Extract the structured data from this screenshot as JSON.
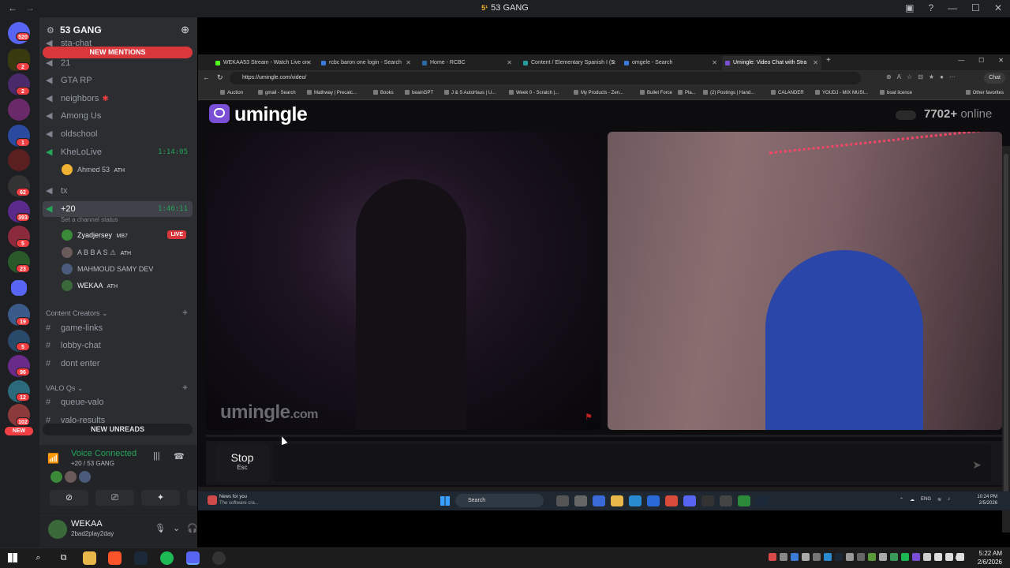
{
  "window": {
    "title": "53 GANG",
    "back": "←",
    "forward": "→"
  },
  "servers": {
    "badges": [
      "520",
      "2",
      "2",
      "1",
      "62",
      "393",
      "5",
      "23",
      "19",
      "5",
      "96",
      "12",
      "102"
    ],
    "new_label": "NEW"
  },
  "guild": {
    "name": "53 GANG",
    "chevron": "⌄"
  },
  "channels": {
    "new_mentions": "NEW MENTIONS",
    "new_unreads": "NEW UNREADS",
    "list": [
      {
        "name": "sta-chat"
      },
      {
        "name": "21"
      },
      {
        "name": "GTA RP"
      },
      {
        "name": "neighbors"
      },
      {
        "name": "Among Us"
      },
      {
        "name": "oldschool"
      },
      {
        "name": "KheLoLive",
        "time": "1:14:05"
      },
      {
        "name": "tx"
      },
      {
        "name": "+20",
        "time": "1:46:11"
      }
    ],
    "kheloLive_member": {
      "name": "Ahmed 53",
      "tag": "ATH"
    },
    "channel_status_placeholder": "Set a channel status",
    "voice_members": [
      {
        "name": "Zyadjersey",
        "tag": "MB7",
        "live": "LIVE"
      },
      {
        "name": "A B B A S ⚠",
        "tag": "ATH"
      },
      {
        "name": "MAHMOUD SAMY DEV",
        "tag": ""
      },
      {
        "name": "WEKAA",
        "tag": "ATH"
      }
    ],
    "categories": [
      {
        "name": "Content Creators",
        "channels": [
          "game-links",
          "lobby-chat",
          "dont enter"
        ]
      },
      {
        "name": "VALO Qs",
        "channels": [
          "queue-valo",
          "valo-results"
        ]
      }
    ]
  },
  "voice": {
    "status": "Voice Connected",
    "location": "+20 / 53 GANG"
  },
  "user": {
    "name": "WEKAA",
    "status": "2bad2play2day"
  },
  "browser": {
    "tabs": [
      "WEKAA53 Stream - Watch Live on",
      "rcbc baron one login - Search",
      "Home - RCBC",
      "Content / Elementary Spanish I (S",
      "omgele - Search",
      "Umingle: Video Chat with Stra"
    ],
    "url": "https://umingle.com/video/",
    "copilot": "Chat",
    "bookmarks": [
      "Auction",
      "gmail - Search",
      "Mathway | Precalc...",
      "Books",
      "beainGPT",
      "J & S AutoHaus | U...",
      "Week 0 - Scratch |...",
      "My Products - Zen...",
      "Bullet Force",
      "Pla...",
      "(2) Postings | Hand...",
      "CALANDER",
      "YOUDJ - MIX MUSI...",
      "boat licence"
    ],
    "other_favorites": "Other favorites"
  },
  "site": {
    "logo": "umingle",
    "online_count": "7702+",
    "online_label": "online",
    "watermark": "umingle",
    "watermark_tld": ".com",
    "stop_label": "Stop",
    "stop_hint": "Esc"
  },
  "inner_taskbar": {
    "news_title": "News for you",
    "news_sub": "The software cra...",
    "search": "Search",
    "lang": "ENG",
    "time": "10:24 PM",
    "date": "2/5/2026"
  },
  "taskbar": {
    "time": "5:22 AM",
    "date": "2/6/2026"
  }
}
